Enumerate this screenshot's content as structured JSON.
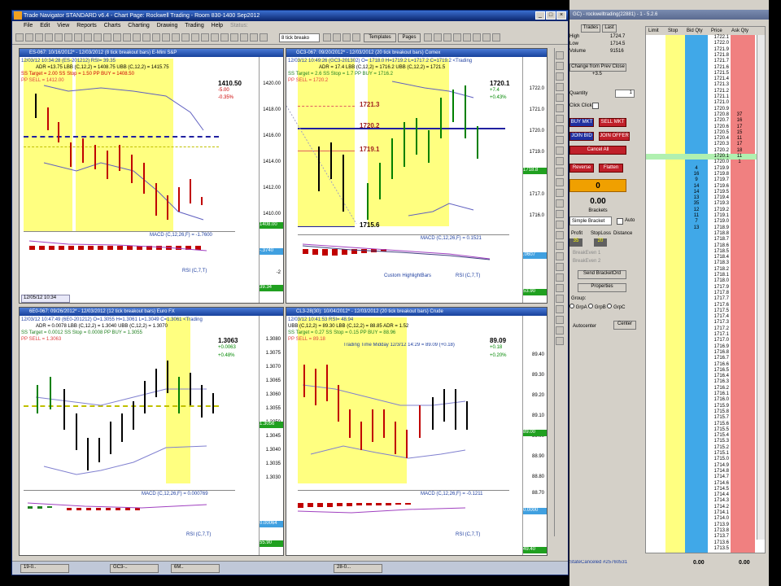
{
  "window": {
    "title": "Trade Navigator STANDARD v6.4  -  Chart Page: Rockwell Trading - Room 830-1400 Sep2012",
    "status": "Status:"
  },
  "menu": [
    "File",
    "Edit",
    "View",
    "Reports",
    "Charts",
    "Charting",
    "Drawing",
    "Trading",
    "Help"
  ],
  "toolbar": {
    "combo": "8 tick breako",
    "templates": "Templates",
    "pages": "Pages"
  },
  "charts": [
    {
      "title": "ES-067: 10/16/2012* - 12/03/2012 (8 tick breakout bars)   E-Mini S&P",
      "info1": "12/03/12 10:34:28 (ES-201212)  RSI= 39.35",
      "info2": "ADR =13.75  LBB (C,12,2) = 1408.75  UBB (C,12,2) = 1415.75",
      "info3": "SS Target = 2.00   SS Stop = 1.50   PP BUY = 1408.50",
      "info4": "PP SELL = 1412.00",
      "last": "1410.50",
      "chg": "-5.00",
      "pct": "-0.35%",
      "yticks": [
        "1420.00",
        "1418.00",
        "1416.00",
        "1414.00",
        "1412.00",
        "1410.00"
      ],
      "ylower": [
        "1408.00"
      ],
      "macd": "MACD (C,12,26,F) = -1.7600",
      "rsi": "RSI (C,7,T)",
      "date": "12/05/12 10:34",
      "box": "1408.00",
      "mval": "-.3740",
      "neg": "-2",
      "rsiv": "39.34"
    },
    {
      "title": "GC3-067: 09/20/2012* - 12/03/2012 (20 tick breakout bars)   Comex",
      "info1": "12/03/12 10:49:26 (GC3-201302)  O= 1718.0  H=1719.2  L=1717.2  C=1719.2  <Trading",
      "info2": "ADR = 17.4   LBB (C,12,2) = 1716.2   UBB (C,12,2) = 1721.5",
      "info3": "SS Target = 2.6   SS Stop = 1.7   PP BUY = 1716.2",
      "info4": "PP SELL = 1720.2",
      "last": "1720.1",
      "chg": "+7.4",
      "pct": "+0.43%",
      "yticks": [
        "1722.0",
        "1721.0",
        "1720.0",
        "1719.0",
        "1718.0",
        "1717.0",
        "1716.0"
      ],
      "levels": [
        "1721.3",
        "1720.2",
        "1719.1",
        "1715.6"
      ],
      "macd": "MACD (C,12,26,F) = 0.1521",
      "custom": "Custom HighlightBars",
      "rsi": "RSI (C,7,T)",
      "box": "1718.8",
      "mval": ".0607",
      "rsiv": "53.90"
    },
    {
      "title": "6E0-067: 09/26/2012* - 12/03/2012 (12 tick breakout bars)   Euro FX",
      "info1": "12/03/12 10:47:49 (6E0-201212)  O=1.3055  H=1.3061  L=1.3049  C=1.3061  <Trading",
      "info2": "ADR = 0.0078   LBB (C,12,2) = 1.3040   UBB (C,12,2) = 1.3070",
      "info3": "SS Target = 0.0012   SS Stop = 0.0008   PP BUY = 1.3055",
      "info4": "PP SELL = 1.3063",
      "last": "1.3063",
      "chg": "+0.0063",
      "pct": "+0.48%",
      "yticks": [
        "1.3080",
        "1.3075",
        "1.3070",
        "1.3065",
        "1.3060",
        "1.3055",
        "1.3050",
        "1.3045",
        "1.3040",
        "1.3035",
        "1.3030"
      ],
      "macd": "MACD (C,12,26,F) = 0.000769",
      "rsi": "RSI (C,7,T)",
      "box": "1.3056",
      "mval": "0.00064",
      "rsiv": "55.90"
    },
    {
      "title": "CL3-28(30): 10/04/2012* - 12/03/2012 (20 tick breakout bars)   Crude",
      "info1": "12/03/12 10:41:53  RSI= 48.94",
      "info2": "UBB (C,12,2) = 89.30  LBB (C,12,2) = 88.85  ADR = 1.52",
      "info3": "SS Target = 0.27   SS Stop = 0.15   PP BUY = 88.96",
      "info4": "PP SELL = 89.18",
      "tt": "Trading Time Midday  12/3/12 14:29 = 89.09 (+0.18)",
      "last": "89.09",
      "chg": "+0.18",
      "pct": "+0.20%",
      "yticks": [
        "89.40",
        "89.30",
        "89.20",
        "89.10",
        "89.00",
        "88.90",
        "88.80",
        "88.70"
      ],
      "macd": "MACD (C,12,26,F) = -0.1211",
      "rsi": "RSI (C,7,T)",
      "box": "89.00",
      "mval": "0.0000",
      "rsiv": "49.40"
    }
  ],
  "taskbar": [
    "19-0..",
    "GC3-..",
    "6M..",
    "28-0..."
  ],
  "side": {
    "titlebar": "GC) - rockwelltrading(22881) - 1 - 5.2.6",
    "tabs": [
      "Trades",
      "Last"
    ],
    "high_l": "High",
    "high_v": "1724.7",
    "low_l": "Low",
    "low_v": "1714.5",
    "vol_l": "Volume",
    "vol_v": "91516",
    "chg_btn": "Change from Prev Close",
    "chg_v": "+3.5",
    "qty_l": "Quantity",
    "qty_v": "1",
    "click_l": "Click Click",
    "buy_mkt": "BUY MKT",
    "sell_mkt": "SELL MKT",
    "join_bid": "JOIN BID",
    "join_offer": "JOIN OFFER",
    "cancel_all": "Cancel All",
    "reverse": "Reverse",
    "flatten": "Flatten",
    "pos": "0",
    "pnl": "0.00",
    "brackets": "Brackets",
    "bracket_sel": "Simple Bracket",
    "auto": "Auto",
    "profit_l": "Profit",
    "stoploss_l": "StopLoss",
    "distance_l": "Distance",
    "profit_v": "35",
    "stop_v": "20",
    "brk1": "BreakEven 1",
    "brk2": "BreakEven 2",
    "send": "Send BracketOrd",
    "props": "Properties",
    "group": "Group:",
    "grpA": "GrpA",
    "grpB": "GrpB",
    "grpC": "GrpC",
    "autocenter": "Autocenter",
    "center": "Center",
    "status": "StateCanceled #25760531"
  },
  "dom": {
    "headers": [
      "Limit",
      "Stop",
      "Bid Qty",
      "Price",
      "Ask Qty"
    ],
    "rows": [
      [
        "",
        "1722.1",
        ""
      ],
      [
        "",
        "1722.0",
        ""
      ],
      [
        "",
        "1721.9",
        ""
      ],
      [
        "",
        "1721.8",
        ""
      ],
      [
        "",
        "1721.7",
        ""
      ],
      [
        "",
        "1721.6",
        ""
      ],
      [
        "",
        "1721.5",
        ""
      ],
      [
        "",
        "1721.4",
        ""
      ],
      [
        "",
        "1721.3",
        ""
      ],
      [
        "",
        "1721.2",
        ""
      ],
      [
        "",
        "1721.1",
        ""
      ],
      [
        "",
        "1721.0",
        ""
      ],
      [
        "",
        "1720.9",
        ""
      ],
      [
        "",
        "1720.8",
        "37"
      ],
      [
        "",
        "1720.7",
        "16"
      ],
      [
        "",
        "1720.6",
        "17"
      ],
      [
        "",
        "1720.5",
        "15"
      ],
      [
        "",
        "1720.4",
        "11"
      ],
      [
        "",
        "1720.3",
        "17"
      ],
      [
        "",
        "1720.2",
        "18"
      ],
      [
        "",
        "1720.1",
        "11"
      ],
      [
        "",
        "1720.0",
        "1"
      ],
      [
        "4",
        "1719.9",
        ""
      ],
      [
        "16",
        "1719.8",
        ""
      ],
      [
        "9",
        "1719.7",
        ""
      ],
      [
        "14",
        "1719.6",
        ""
      ],
      [
        "14",
        "1719.5",
        ""
      ],
      [
        "13",
        "1719.4",
        ""
      ],
      [
        "35",
        "1719.3",
        ""
      ],
      [
        "12",
        "1719.2",
        ""
      ],
      [
        "11",
        "1719.1",
        ""
      ],
      [
        "7",
        "1719.0",
        ""
      ],
      [
        "13",
        "1718.9",
        ""
      ],
      [
        "",
        "1718.8",
        ""
      ],
      [
        "",
        "1718.7",
        ""
      ],
      [
        "",
        "1718.6",
        ""
      ],
      [
        "",
        "1718.5",
        ""
      ],
      [
        "",
        "1718.4",
        ""
      ],
      [
        "",
        "1718.3",
        ""
      ],
      [
        "",
        "1718.2",
        ""
      ],
      [
        "",
        "1718.1",
        ""
      ],
      [
        "",
        "1718.0",
        ""
      ],
      [
        "",
        "1717.9",
        ""
      ],
      [
        "",
        "1717.8",
        ""
      ],
      [
        "",
        "1717.7",
        ""
      ],
      [
        "",
        "1717.6",
        ""
      ],
      [
        "",
        "1717.5",
        ""
      ],
      [
        "",
        "1717.4",
        ""
      ],
      [
        "",
        "1717.3",
        ""
      ],
      [
        "",
        "1717.2",
        ""
      ],
      [
        "",
        "1717.1",
        ""
      ],
      [
        "",
        "1717.0",
        ""
      ],
      [
        "",
        "1716.9",
        ""
      ],
      [
        "",
        "1716.8",
        ""
      ],
      [
        "",
        "1716.7",
        ""
      ],
      [
        "",
        "1716.6",
        ""
      ],
      [
        "",
        "1716.5",
        ""
      ],
      [
        "",
        "1716.4",
        ""
      ],
      [
        "",
        "1716.3",
        ""
      ],
      [
        "",
        "1716.2",
        ""
      ],
      [
        "",
        "1716.1",
        ""
      ],
      [
        "",
        "1716.0",
        ""
      ],
      [
        "",
        "1715.9",
        ""
      ],
      [
        "",
        "1715.8",
        ""
      ],
      [
        "",
        "1715.7",
        ""
      ],
      [
        "",
        "1715.6",
        ""
      ],
      [
        "",
        "1715.5",
        ""
      ],
      [
        "",
        "1715.4",
        ""
      ],
      [
        "",
        "1715.3",
        ""
      ],
      [
        "",
        "1715.2",
        ""
      ],
      [
        "",
        "1715.1",
        ""
      ],
      [
        "",
        "1715.0",
        ""
      ],
      [
        "",
        "1714.9",
        ""
      ],
      [
        "",
        "1714.8",
        ""
      ],
      [
        "",
        "1714.7",
        ""
      ],
      [
        "",
        "1714.6",
        ""
      ],
      [
        "",
        "1714.5",
        ""
      ],
      [
        "",
        "1714.4",
        ""
      ],
      [
        "",
        "1714.3",
        ""
      ],
      [
        "",
        "1714.2",
        ""
      ],
      [
        "",
        "1714.1",
        ""
      ],
      [
        "",
        "1714.0",
        ""
      ],
      [
        "",
        "1713.9",
        ""
      ],
      [
        "",
        "1713.8",
        ""
      ],
      [
        "",
        "1713.7",
        ""
      ],
      [
        "",
        "1713.6",
        ""
      ],
      [
        "",
        "1713.5",
        ""
      ]
    ],
    "highlight_price": "1720.1",
    "footer_bid": "0.00",
    "footer_ask": "0.00"
  },
  "colors": {
    "accent": "#0a246a",
    "highlight": "#ffff80",
    "bull": "#00a000",
    "bear": "#c00000",
    "ask": "#f08080",
    "bid": "#40a8e8",
    "limit": "#ffff80"
  }
}
